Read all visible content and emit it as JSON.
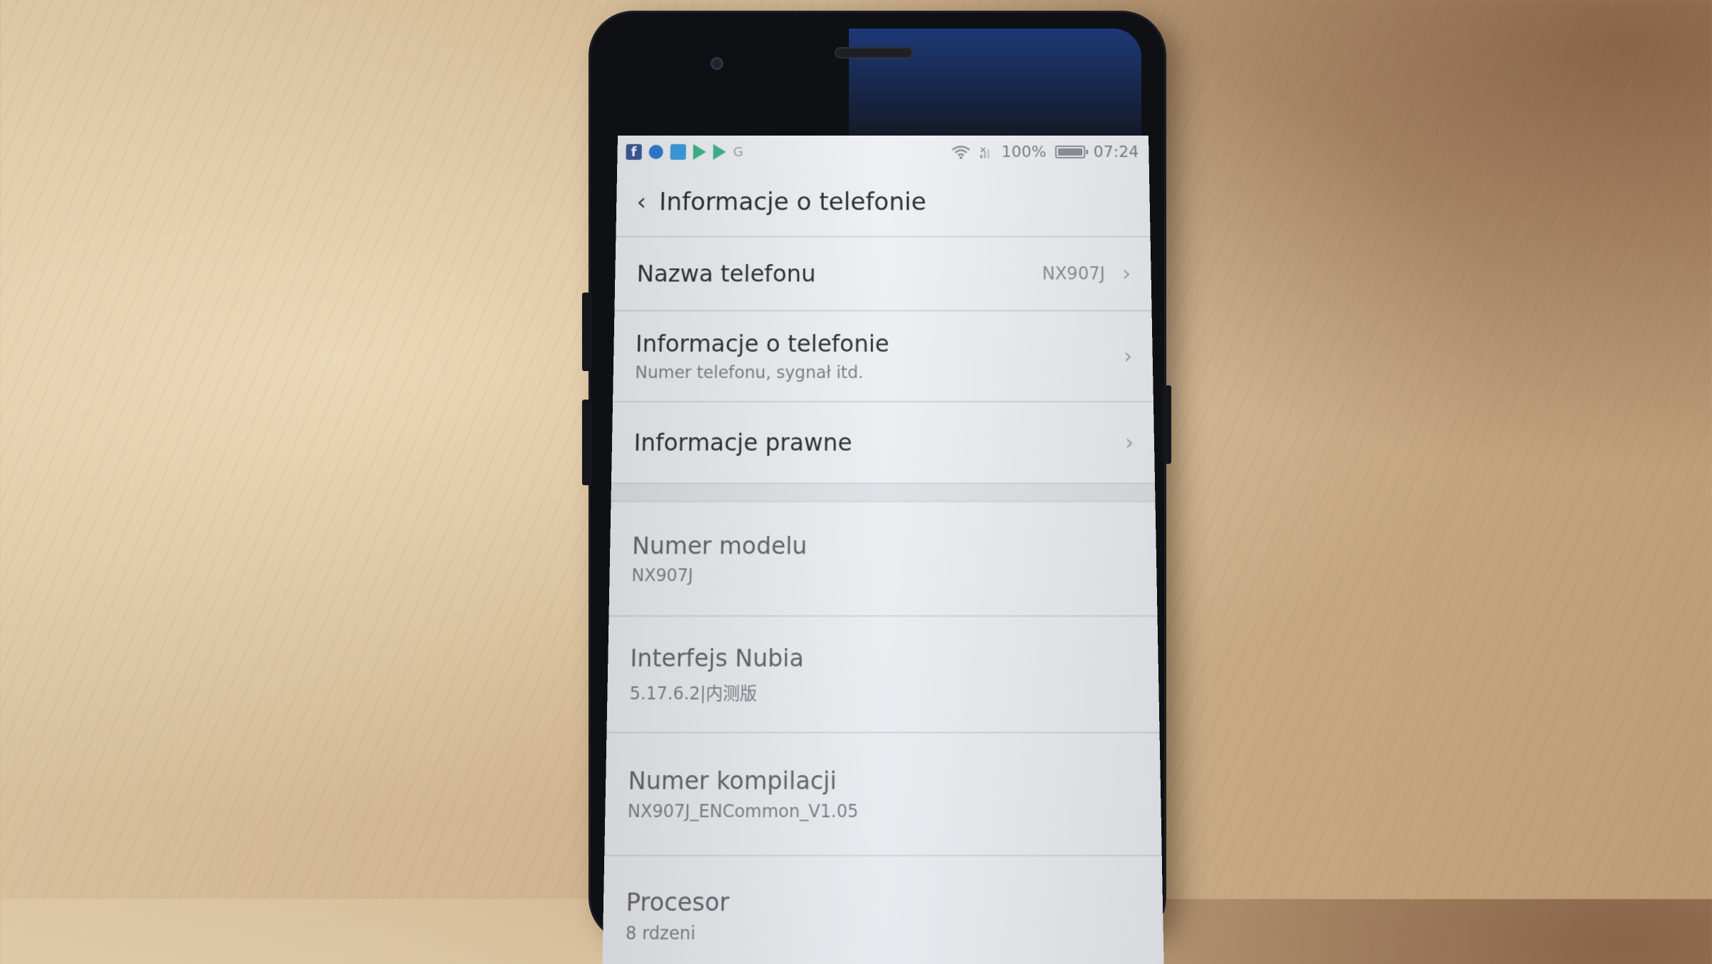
{
  "status_bar": {
    "notification_icons": [
      "facebook-icon",
      "messenger-icon",
      "twitter-icon",
      "play-store-icon",
      "play-store-icon",
      "google-icon"
    ],
    "battery_percent": "100%",
    "time": "07:24"
  },
  "header": {
    "back_icon": "chevron-left-icon",
    "title": "Informacje o telefonie"
  },
  "settings_items": [
    {
      "label": "Nazwa telefonu",
      "value": "NX907J"
    },
    {
      "label": "Informacje o telefonie",
      "subtitle": "Numer telefonu, sygnał itd."
    },
    {
      "label": "Informacje prawne"
    }
  ],
  "info_items": [
    {
      "label": "Numer modelu",
      "value": "NX907J"
    },
    {
      "label": "Interfejs Nubia",
      "value": "5.17.6.2|内测版"
    },
    {
      "label": "Numer kompilacji",
      "value": "NX907J_ENCommon_V1.05"
    },
    {
      "label": "Procesor",
      "value": "8 rdzeni"
    }
  ]
}
